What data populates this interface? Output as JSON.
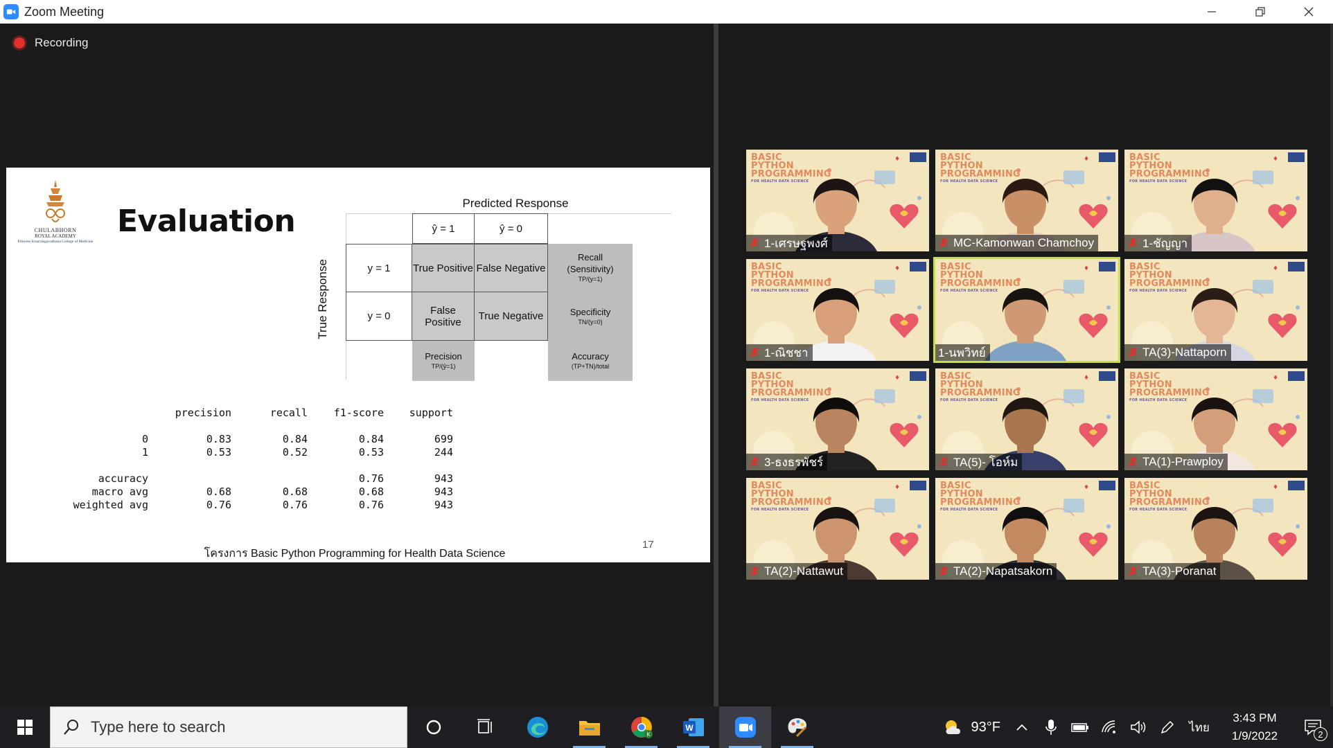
{
  "window": {
    "title": "Zoom Meeting"
  },
  "meeting": {
    "recording_label": "Recording"
  },
  "slide": {
    "logo_line1": "CHULABHORN",
    "logo_line2": "ROYAL ACADEMY",
    "logo_line3": "Princess Srisavangavadhana College of Medicine",
    "title": "Evaluation",
    "matrix": {
      "predicted_header": "Predicted Response",
      "true_header": "True Response",
      "pred_pos": "ŷ = 1",
      "pred_neg": "ŷ = 0",
      "true_pos": "y = 1",
      "true_neg": "y = 0",
      "tp": "True Positive",
      "fn": "False Negative",
      "fp": "False Positive",
      "tn": "True Negative",
      "recall_title": "Recall",
      "recall_sub": "(Sensitivity)",
      "recall_formula": "TP/(y=1)",
      "specificity_title": "Specificity",
      "specificity_formula": "TN/(y=0)",
      "precision_title": "Precision",
      "precision_formula": "TP/(ŷ=1)",
      "accuracy_title": "Accuracy",
      "accuracy_formula": "(TP+TN)/total"
    },
    "report": {
      "headers": [
        "precision",
        "recall",
        "f1-score",
        "support"
      ],
      "rows": [
        {
          "label": "0",
          "precision": "0.83",
          "recall": "0.84",
          "f1": "0.84",
          "support": "699"
        },
        {
          "label": "1",
          "precision": "0.53",
          "recall": "0.52",
          "f1": "0.53",
          "support": "244"
        },
        {
          "label": "accuracy",
          "precision": "",
          "recall": "",
          "f1": "0.76",
          "support": "943"
        },
        {
          "label": "macro avg",
          "precision": "0.68",
          "recall": "0.68",
          "f1": "0.68",
          "support": "943"
        },
        {
          "label": "weighted avg",
          "precision": "0.76",
          "recall": "0.76",
          "f1": "0.76",
          "support": "943"
        }
      ]
    },
    "footer": "โครงการ Basic Python Programming for Health Data Science",
    "page_number": "17"
  },
  "gallery": {
    "banner_title": "BASIC PYTHON PROGRAMMING",
    "banner_sub": "FOR HEALTH DATA SCIENCE",
    "participants": [
      {
        "name": "1-เศรษฐพงศ์",
        "muted": true,
        "active": false
      },
      {
        "name": "MC-Kamonwan Chamchoy",
        "muted": true,
        "active": false
      },
      {
        "name": "1-ชัญญา",
        "muted": true,
        "active": false
      },
      {
        "name": "1-ณิชชา",
        "muted": true,
        "active": false
      },
      {
        "name": "1-นพวิทย์",
        "muted": false,
        "active": true
      },
      {
        "name": "TA(3)-Nattaporn",
        "muted": true,
        "active": false
      },
      {
        "name": "3-ธงธรพัชร์",
        "muted": true,
        "active": false
      },
      {
        "name": "TA(5)- โอห์ม",
        "muted": true,
        "active": false
      },
      {
        "name": "TA(1)-Prawploy",
        "muted": true,
        "active": false
      },
      {
        "name": "TA(2)-Nattawut",
        "muted": true,
        "active": false
      },
      {
        "name": "TA(2)-Napatsakorn",
        "muted": true,
        "active": false
      },
      {
        "name": "TA(3)-Poranat",
        "muted": true,
        "active": false
      }
    ]
  },
  "taskbar": {
    "search_placeholder": "Type here to search",
    "weather": "93°F",
    "language": "ไทย",
    "time": "3:43 PM",
    "date": "1/9/2022",
    "notification_count": "2"
  },
  "colors": {
    "accent": "#2d8cff",
    "active_speaker": "#c7e04a",
    "recording": "#e0302b"
  }
}
